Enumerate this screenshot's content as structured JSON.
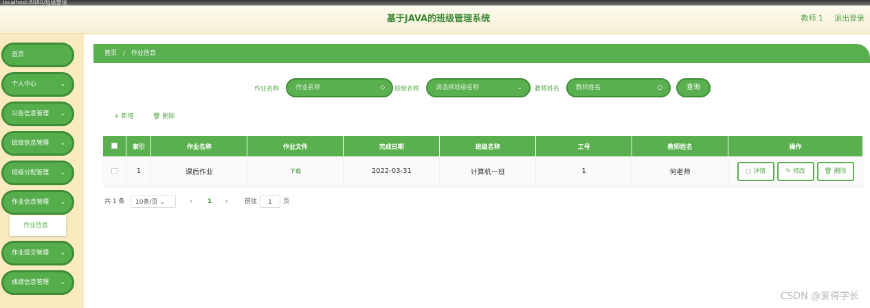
{
  "window": {
    "title": "localhost:8080/班级管理"
  },
  "header": {
    "title": "基于JAVA的班级管理系统",
    "user": "教师 1",
    "logout": "退出登录"
  },
  "sidebar": {
    "items": [
      {
        "label": "首页",
        "has_sub": false
      },
      {
        "label": "个人中心",
        "has_sub": true
      },
      {
        "label": "公告信息管理",
        "has_sub": true
      },
      {
        "label": "班级信息管理",
        "has_sub": true
      },
      {
        "label": "班级分配管理",
        "has_sub": true
      },
      {
        "label": "作业信息管理",
        "has_sub": true
      },
      {
        "label": "作业提交管理",
        "has_sub": true
      },
      {
        "label": "成绩信息管理",
        "has_sub": true
      }
    ],
    "submenu_label": "作业信息"
  },
  "breadcrumb": {
    "home": "首页",
    "sep": "/",
    "current": "作业信息"
  },
  "search": {
    "label1": "作业名称",
    "placeholder1": "作业名称",
    "label2": "班级名称",
    "placeholder2": "请选择班级名称",
    "label3": "教师姓名",
    "placeholder3": "教师姓名",
    "button": "查询"
  },
  "toolbar": {
    "add": "新增",
    "delete": "删除"
  },
  "table": {
    "headers": [
      "",
      "索引",
      "作业名称",
      "作业文件",
      "完成日期",
      "班级名称",
      "工号",
      "教师姓名",
      "操作"
    ],
    "rows": [
      {
        "index": "1",
        "name": "课后作业",
        "file": "下载",
        "date": "2022-03-31",
        "class": "计算机一班",
        "job_no": "1",
        "teacher": "何老师"
      }
    ],
    "actions": {
      "detail": "详情",
      "edit": "修改",
      "delete": "删除"
    }
  },
  "pager": {
    "total": "共 1 条",
    "page_size": "10条/页",
    "prev": "‹",
    "current": "1",
    "next": "›",
    "goto": "前往",
    "goto_value": "1",
    "page_unit": "页"
  },
  "watermark": "CSDN @爱得学长",
  "colors": {
    "primary": "#5aaf4f",
    "border": "#3f8e37",
    "sidebar_bg": "#f9eac0"
  }
}
